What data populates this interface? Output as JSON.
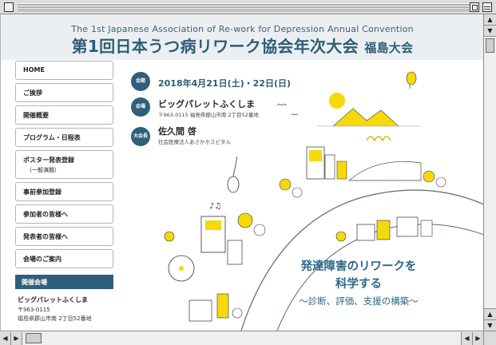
{
  "header": {
    "en_title": "The 1st Japanese Association of Re-work for Depression Annual Convention",
    "jp_title": "第1回日本うつ病リワーク協会年次大会",
    "jp_subtitle": "福島大会"
  },
  "nav": {
    "items": [
      {
        "label": "HOME"
      },
      {
        "label": "ご挨拶"
      },
      {
        "label": "開催概要"
      },
      {
        "label": "プログラム・日程表"
      },
      {
        "label": "ポスター発表登録",
        "sub": "（一般演題）"
      },
      {
        "label": "事前参加登録"
      },
      {
        "label": "参加者の皆様へ"
      },
      {
        "label": "発表者の皆様へ"
      },
      {
        "label": "会場のご案内"
      }
    ]
  },
  "venue": {
    "heading": "開催会場",
    "name": "ビッグパレットふくしま",
    "zip": "〒963-0115",
    "address": "福島県郡山市南 2丁目52番地"
  },
  "event": {
    "date_badge": "会期",
    "date": "2018年4月21日(土)・22日(日)",
    "place_badge": "会場",
    "place": "ビッグパレットふくしま",
    "place_address": "〒963-0115 福島県郡山市南 2丁目52番地",
    "chair_badge": "大会長",
    "chair": "佐久間 啓",
    "chair_org": "社会医療法人あさかホスピタル"
  },
  "tagline": {
    "line1": "発達障害のリワークを",
    "line2": "科学する",
    "line3": "～診断、評価、支援の構築～"
  },
  "colors": {
    "brand": "#2f5f7a",
    "accent_yellow": "#f5d90a",
    "header_bg": "#eceff1"
  }
}
